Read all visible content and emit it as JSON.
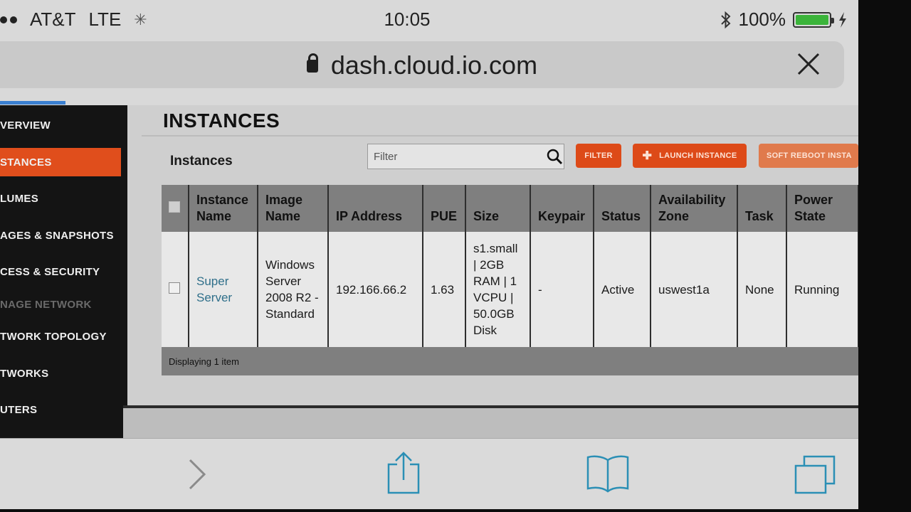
{
  "status_bar": {
    "carrier": "AT&T",
    "network": "LTE",
    "time": "10:05",
    "battery_percent": "100%",
    "battery_level": 1.0
  },
  "browser": {
    "url": "dash.cloud.io.com"
  },
  "sidebar": {
    "items": [
      {
        "label": "VERVIEW"
      },
      {
        "label": "STANCES"
      },
      {
        "label": "LUMES"
      },
      {
        "label": "AGES & SNAPSHOTS"
      },
      {
        "label": "CESS & SECURITY"
      },
      {
        "label": "NAGE NETWORK"
      },
      {
        "label": "TWORK TOPOLOGY"
      },
      {
        "label": "TWORKS"
      },
      {
        "label": "UTERS"
      }
    ]
  },
  "main": {
    "title": "INSTANCES",
    "section_label": "Instances",
    "filter_placeholder": "Filter",
    "buttons": {
      "filter": "FILTER",
      "launch": "LAUNCH INSTANCE",
      "soft_reboot": "SOFT REBOOT INSTA"
    },
    "table": {
      "columns": [
        "Instance Name",
        "Image Name",
        "IP Address",
        "PUE",
        "Size",
        "Keypair",
        "Status",
        "Availability Zone",
        "Task",
        "Power State"
      ],
      "rows": [
        {
          "instance_name": "Super Server",
          "image_name": "Windows Server 2008 R2 - Standard",
          "ip_address": "192.166.66.2",
          "pue": "1.63",
          "size": "s1.small | 2GB RAM | 1 VCPU | 50.0GB Disk",
          "keypair": "-",
          "status": "Active",
          "availability_zone": "uswest1a",
          "task": "None",
          "power_state": "Running"
        }
      ],
      "footer": "Displaying 1 item"
    }
  },
  "colors": {
    "accent": "#dd4a18",
    "sidebar_bg": "#141414",
    "battery": "#3bb43a",
    "link": "#2f6f8a"
  },
  "icons": [
    "lock-icon",
    "close-icon",
    "search-icon",
    "plus-icon",
    "forward-icon",
    "share-icon",
    "bookmarks-icon",
    "tabs-icon",
    "bluetooth-icon",
    "battery-icon"
  ]
}
